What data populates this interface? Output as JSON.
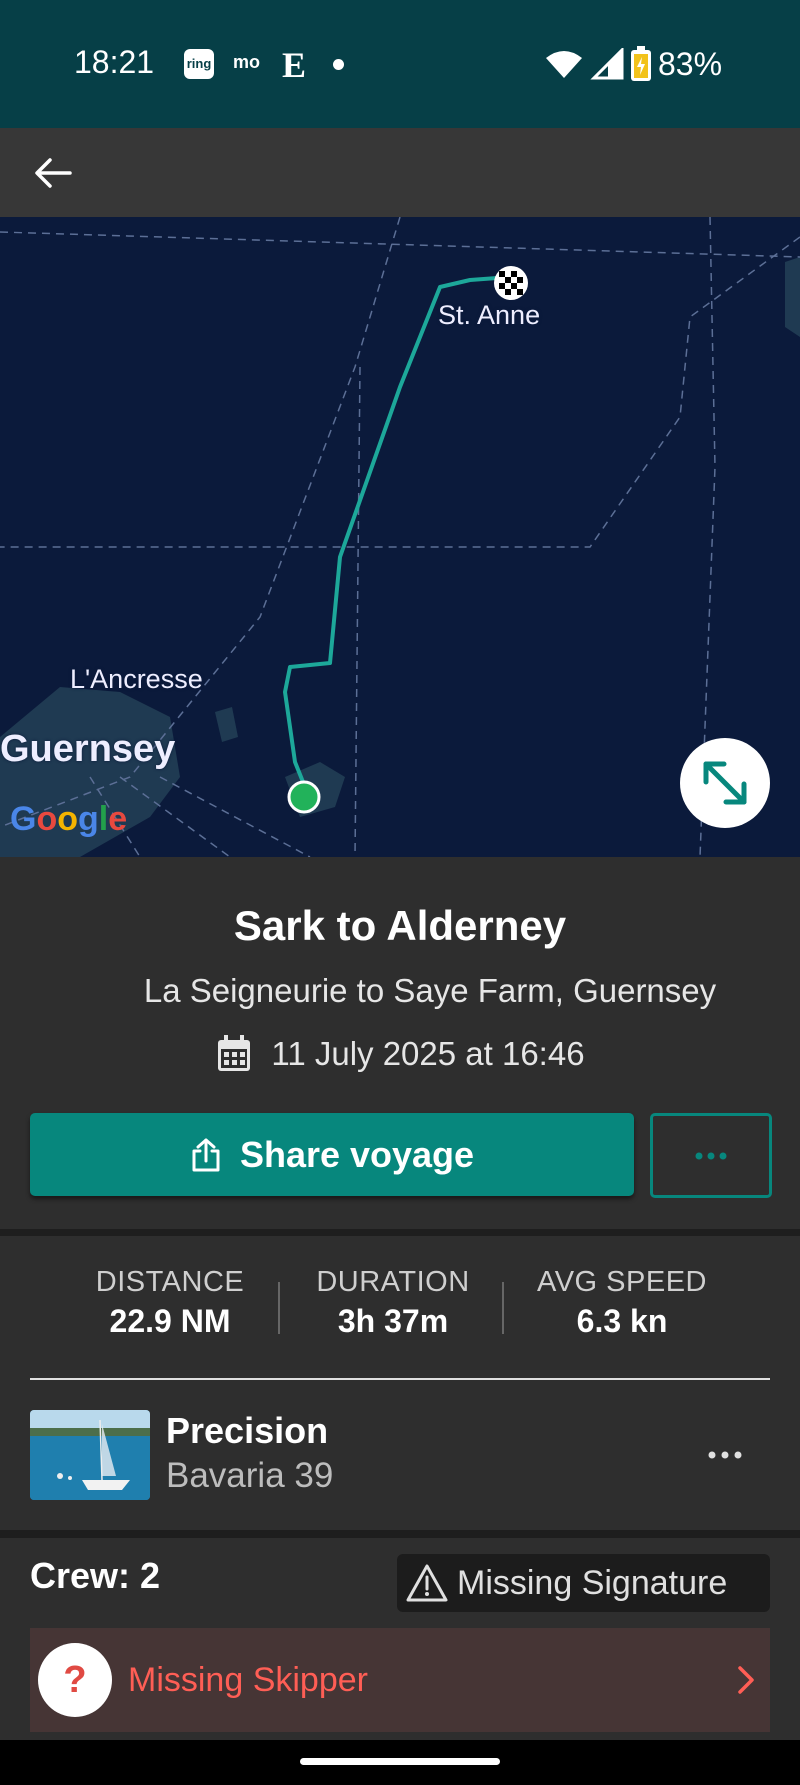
{
  "status_bar": {
    "time": "18:21",
    "ring_label": "ring",
    "mo_label": "mo",
    "e_label": "E",
    "battery_percent": "83%",
    "battery_level": 0.83
  },
  "map": {
    "labels": {
      "st_anne": "St. Anne",
      "lancresse": "L'Ancresse",
      "guernsey": "Guernsey"
    },
    "google_logo": "Google",
    "colors": {
      "track": "#1da89a",
      "start_marker": "#22b25a",
      "water": "#0b1a3b",
      "land": "#1f3a52"
    }
  },
  "voyage": {
    "title": "Sark to Alderney",
    "route": "La Seigneurie to Saye Farm, Guernsey",
    "datetime": "11 July 2025 at 16:46",
    "share_label": "Share voyage"
  },
  "stats": {
    "distance": {
      "label": "DISTANCE",
      "value": "22.9 NM"
    },
    "duration": {
      "label": "DURATION",
      "value": "3h 37m"
    },
    "avg_speed": {
      "label": "AVG SPEED",
      "value": "6.3 kn"
    }
  },
  "boat": {
    "name": "Precision",
    "model": "Bavaria 39"
  },
  "crew": {
    "label": "Crew: 2",
    "missing_signature": "Missing Signature",
    "missing_skipper": "Missing Skipper",
    "missing_skipper_icon": "?"
  },
  "accent": "#07877d"
}
